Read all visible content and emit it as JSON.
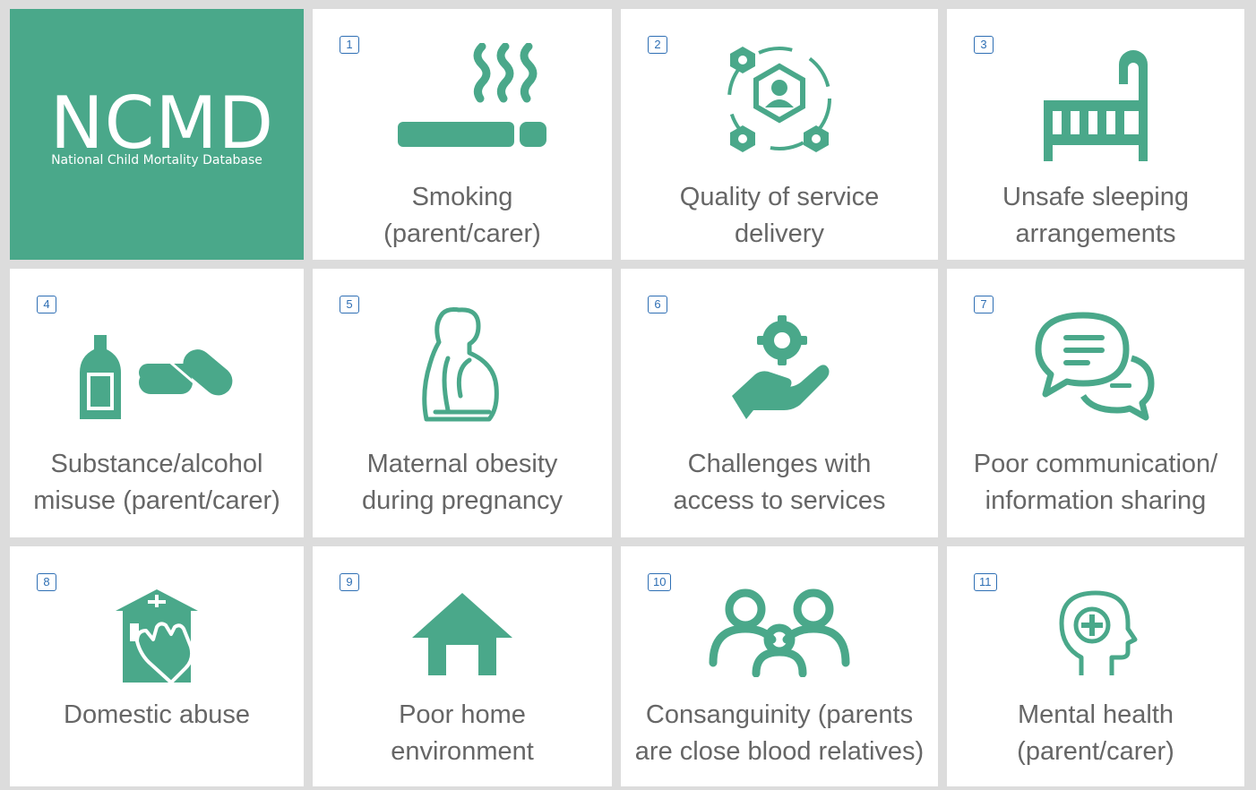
{
  "brand": {
    "logo": "NCMD",
    "subtitle": "National Child Mortality Database",
    "color": "#4aa88a"
  },
  "accent_color": "#4aa88a",
  "badge_color": "#2f6fb4",
  "factors": [
    {
      "number": "1",
      "line1": "Smoking",
      "line2": "(parent/carer)",
      "icon": "cigarette-icon"
    },
    {
      "number": "2",
      "line1": "Quality of service",
      "line2": "delivery",
      "icon": "service-network-icon"
    },
    {
      "number": "3",
      "line1": "Unsafe sleeping",
      "line2": "arrangements",
      "icon": "crib-icon"
    },
    {
      "number": "4",
      "line1": "Substance/alcohol",
      "line2": "misuse (parent/carer)",
      "icon": "bottle-pills-icon"
    },
    {
      "number": "5",
      "line1": "Maternal obesity",
      "line2": "during pregnancy",
      "icon": "pregnant-woman-icon"
    },
    {
      "number": "6",
      "line1": "Challenges with",
      "line2": "access to services",
      "icon": "hand-gear-icon"
    },
    {
      "number": "7",
      "line1": "Poor communication/",
      "line2": "information sharing",
      "icon": "speech-bubbles-icon"
    },
    {
      "number": "8",
      "line1": "Domestic abuse",
      "line2": "",
      "icon": "house-fist-icon"
    },
    {
      "number": "9",
      "line1": "Poor home",
      "line2": "environment",
      "icon": "house-icon"
    },
    {
      "number": "10",
      "line1": "Consanguinity (parents",
      "line2": "are close blood relatives)",
      "icon": "family-icon"
    },
    {
      "number": "11",
      "line1": "Mental health",
      "line2": "(parent/carer)",
      "icon": "head-plus-icon"
    }
  ]
}
